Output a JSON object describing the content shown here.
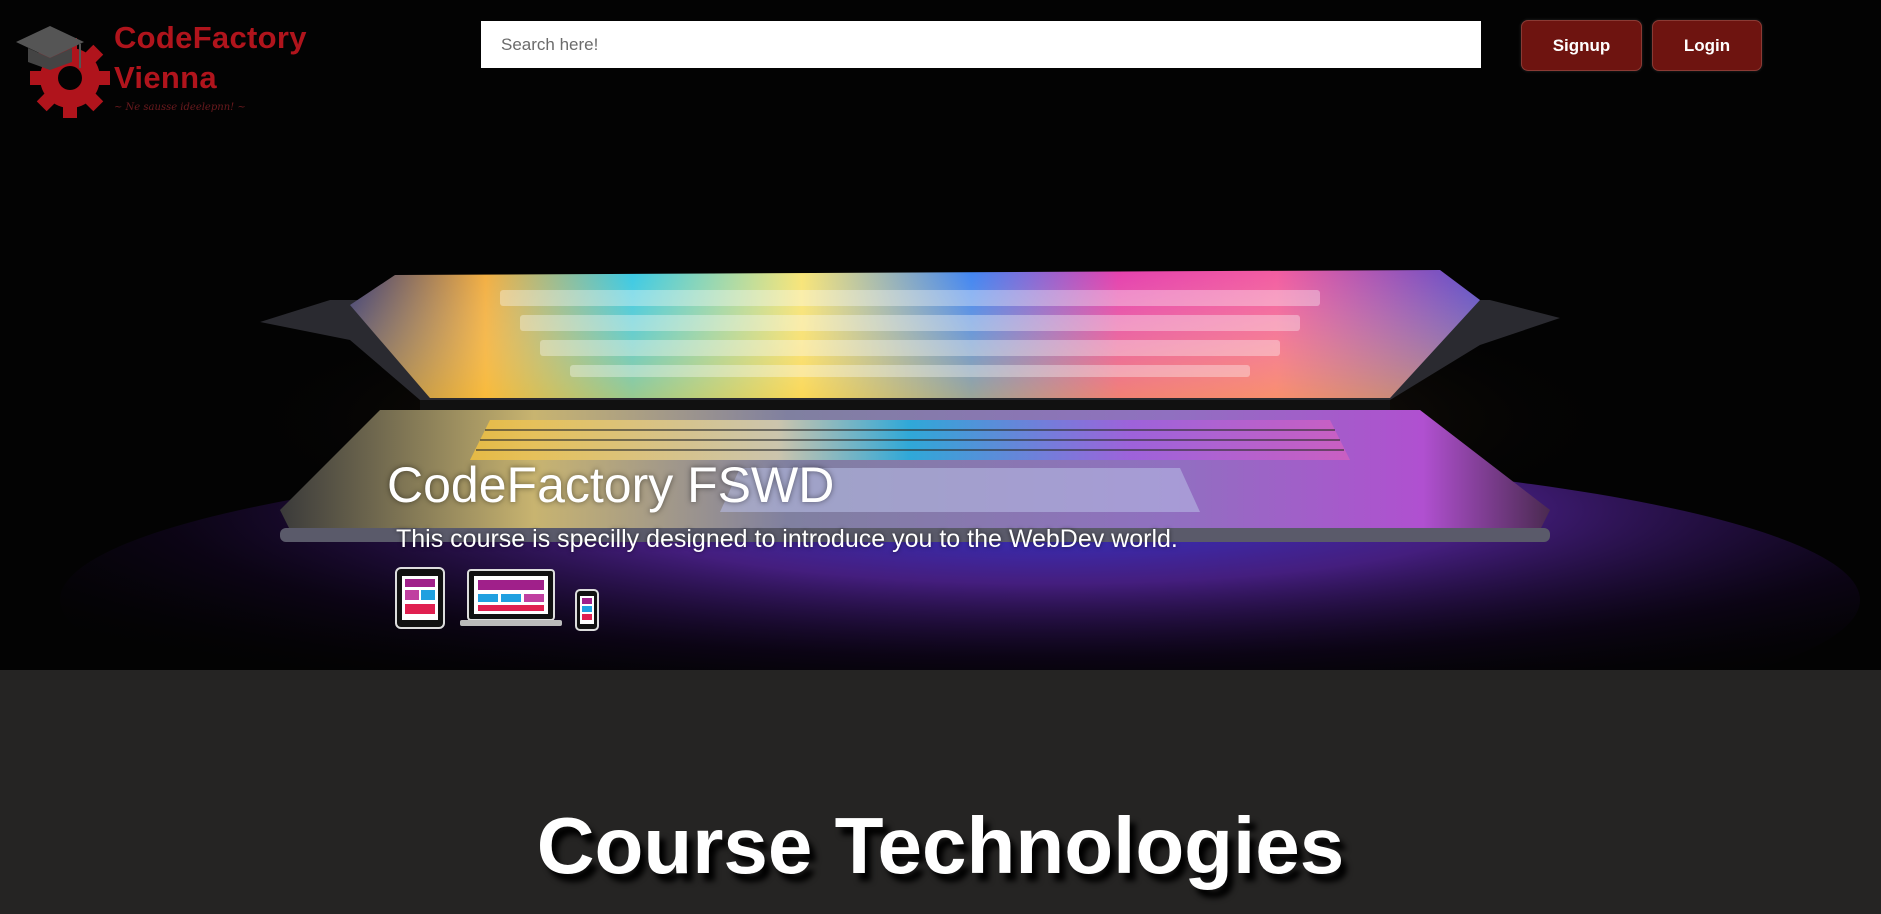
{
  "brand": {
    "name_line1": "CodeFactory",
    "name_line2": "Vienna",
    "tagline": "~ Ne sausse ideelepnn! ~",
    "color": "#b0141c"
  },
  "header": {
    "search": {
      "placeholder": "Search here!",
      "value": ""
    },
    "signup_label": "Signup",
    "login_label": "Login",
    "button_color": "#6e1410"
  },
  "hero": {
    "title": "CodeFactory FSWD",
    "subtitle": "This course is specilly designed to introduce you to the WebDev world.",
    "devices": [
      "tablet-icon",
      "laptop-icon",
      "phone-icon"
    ]
  },
  "section": {
    "title": "Course Technologies",
    "background": "#252423"
  }
}
